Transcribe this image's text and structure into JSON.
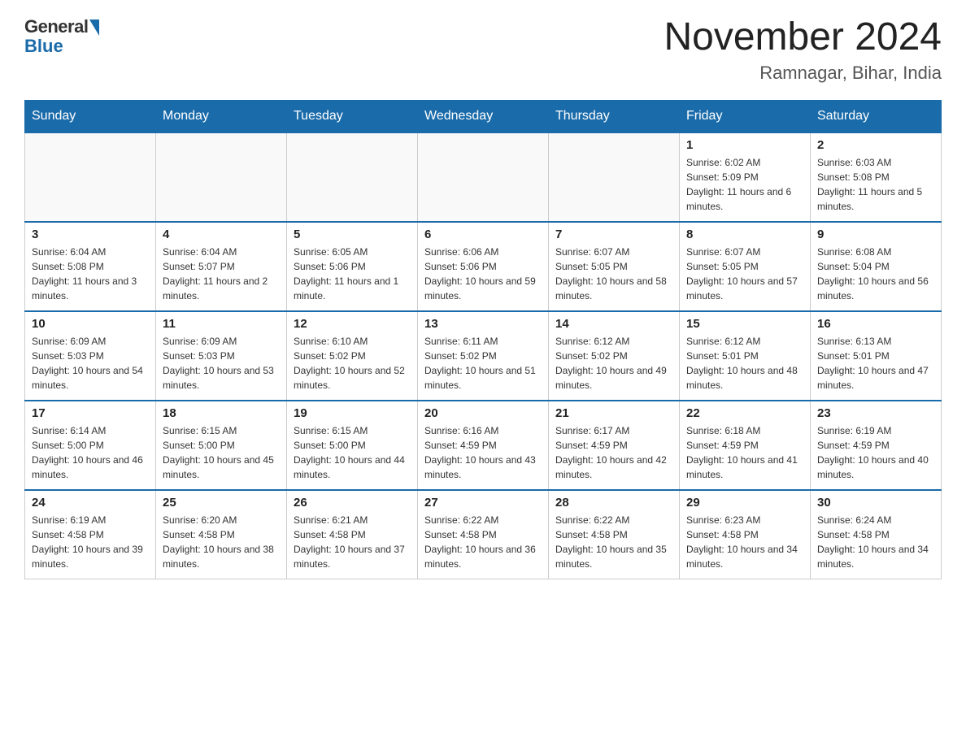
{
  "header": {
    "logo_general": "General",
    "logo_blue": "Blue",
    "title": "November 2024",
    "subtitle": "Ramnagar, Bihar, India"
  },
  "days_of_week": [
    "Sunday",
    "Monday",
    "Tuesday",
    "Wednesday",
    "Thursday",
    "Friday",
    "Saturday"
  ],
  "weeks": [
    [
      {
        "day": "",
        "info": ""
      },
      {
        "day": "",
        "info": ""
      },
      {
        "day": "",
        "info": ""
      },
      {
        "day": "",
        "info": ""
      },
      {
        "day": "",
        "info": ""
      },
      {
        "day": "1",
        "info": "Sunrise: 6:02 AM\nSunset: 5:09 PM\nDaylight: 11 hours and 6 minutes."
      },
      {
        "day": "2",
        "info": "Sunrise: 6:03 AM\nSunset: 5:08 PM\nDaylight: 11 hours and 5 minutes."
      }
    ],
    [
      {
        "day": "3",
        "info": "Sunrise: 6:04 AM\nSunset: 5:08 PM\nDaylight: 11 hours and 3 minutes."
      },
      {
        "day": "4",
        "info": "Sunrise: 6:04 AM\nSunset: 5:07 PM\nDaylight: 11 hours and 2 minutes."
      },
      {
        "day": "5",
        "info": "Sunrise: 6:05 AM\nSunset: 5:06 PM\nDaylight: 11 hours and 1 minute."
      },
      {
        "day": "6",
        "info": "Sunrise: 6:06 AM\nSunset: 5:06 PM\nDaylight: 10 hours and 59 minutes."
      },
      {
        "day": "7",
        "info": "Sunrise: 6:07 AM\nSunset: 5:05 PM\nDaylight: 10 hours and 58 minutes."
      },
      {
        "day": "8",
        "info": "Sunrise: 6:07 AM\nSunset: 5:05 PM\nDaylight: 10 hours and 57 minutes."
      },
      {
        "day": "9",
        "info": "Sunrise: 6:08 AM\nSunset: 5:04 PM\nDaylight: 10 hours and 56 minutes."
      }
    ],
    [
      {
        "day": "10",
        "info": "Sunrise: 6:09 AM\nSunset: 5:03 PM\nDaylight: 10 hours and 54 minutes."
      },
      {
        "day": "11",
        "info": "Sunrise: 6:09 AM\nSunset: 5:03 PM\nDaylight: 10 hours and 53 minutes."
      },
      {
        "day": "12",
        "info": "Sunrise: 6:10 AM\nSunset: 5:02 PM\nDaylight: 10 hours and 52 minutes."
      },
      {
        "day": "13",
        "info": "Sunrise: 6:11 AM\nSunset: 5:02 PM\nDaylight: 10 hours and 51 minutes."
      },
      {
        "day": "14",
        "info": "Sunrise: 6:12 AM\nSunset: 5:02 PM\nDaylight: 10 hours and 49 minutes."
      },
      {
        "day": "15",
        "info": "Sunrise: 6:12 AM\nSunset: 5:01 PM\nDaylight: 10 hours and 48 minutes."
      },
      {
        "day": "16",
        "info": "Sunrise: 6:13 AM\nSunset: 5:01 PM\nDaylight: 10 hours and 47 minutes."
      }
    ],
    [
      {
        "day": "17",
        "info": "Sunrise: 6:14 AM\nSunset: 5:00 PM\nDaylight: 10 hours and 46 minutes."
      },
      {
        "day": "18",
        "info": "Sunrise: 6:15 AM\nSunset: 5:00 PM\nDaylight: 10 hours and 45 minutes."
      },
      {
        "day": "19",
        "info": "Sunrise: 6:15 AM\nSunset: 5:00 PM\nDaylight: 10 hours and 44 minutes."
      },
      {
        "day": "20",
        "info": "Sunrise: 6:16 AM\nSunset: 4:59 PM\nDaylight: 10 hours and 43 minutes."
      },
      {
        "day": "21",
        "info": "Sunrise: 6:17 AM\nSunset: 4:59 PM\nDaylight: 10 hours and 42 minutes."
      },
      {
        "day": "22",
        "info": "Sunrise: 6:18 AM\nSunset: 4:59 PM\nDaylight: 10 hours and 41 minutes."
      },
      {
        "day": "23",
        "info": "Sunrise: 6:19 AM\nSunset: 4:59 PM\nDaylight: 10 hours and 40 minutes."
      }
    ],
    [
      {
        "day": "24",
        "info": "Sunrise: 6:19 AM\nSunset: 4:58 PM\nDaylight: 10 hours and 39 minutes."
      },
      {
        "day": "25",
        "info": "Sunrise: 6:20 AM\nSunset: 4:58 PM\nDaylight: 10 hours and 38 minutes."
      },
      {
        "day": "26",
        "info": "Sunrise: 6:21 AM\nSunset: 4:58 PM\nDaylight: 10 hours and 37 minutes."
      },
      {
        "day": "27",
        "info": "Sunrise: 6:22 AM\nSunset: 4:58 PM\nDaylight: 10 hours and 36 minutes."
      },
      {
        "day": "28",
        "info": "Sunrise: 6:22 AM\nSunset: 4:58 PM\nDaylight: 10 hours and 35 minutes."
      },
      {
        "day": "29",
        "info": "Sunrise: 6:23 AM\nSunset: 4:58 PM\nDaylight: 10 hours and 34 minutes."
      },
      {
        "day": "30",
        "info": "Sunrise: 6:24 AM\nSunset: 4:58 PM\nDaylight: 10 hours and 34 minutes."
      }
    ]
  ]
}
